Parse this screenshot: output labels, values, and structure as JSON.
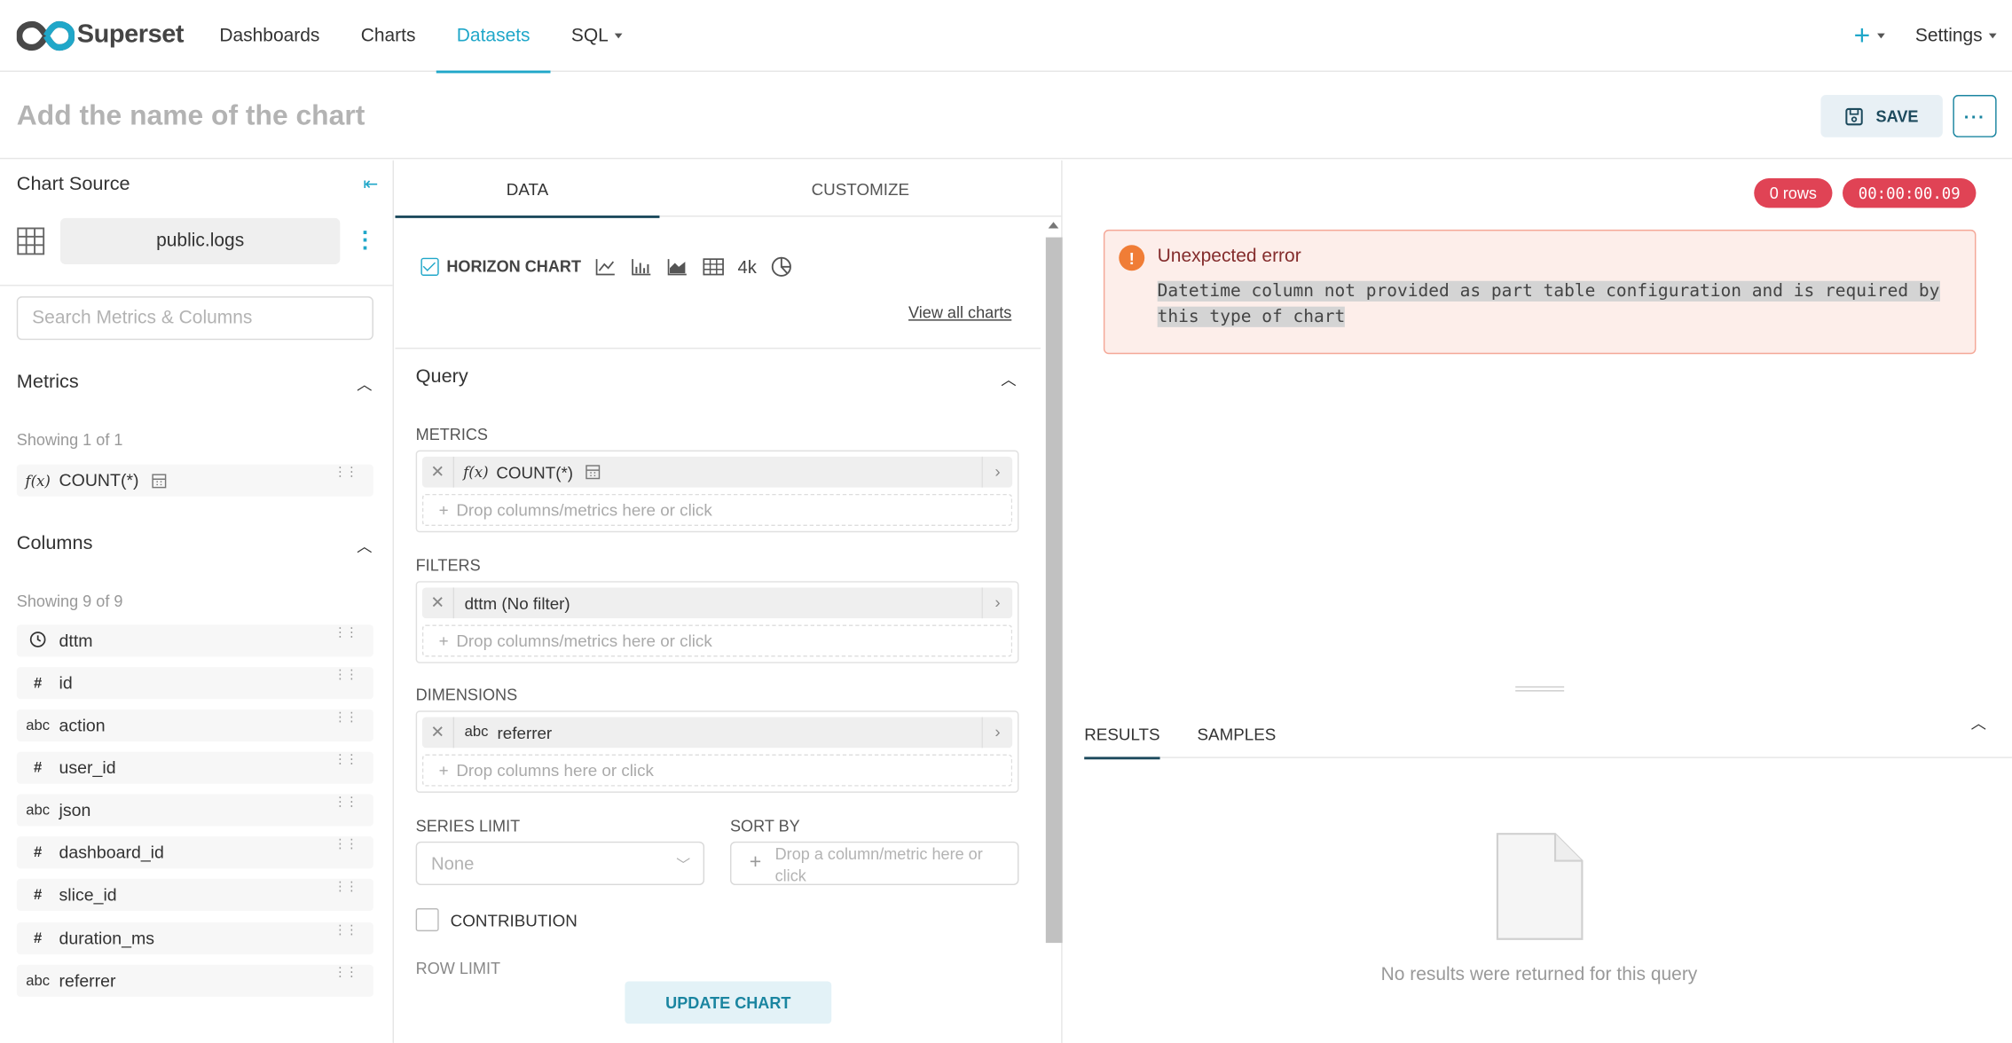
{
  "navbar": {
    "brand": "Superset",
    "menu": [
      "Dashboards",
      "Charts",
      "Datasets",
      "SQL"
    ],
    "active_menu": "Datasets",
    "settings": "Settings"
  },
  "header": {
    "title_placeholder": "Add the name of the chart",
    "save_label": "SAVE",
    "more_label": "···"
  },
  "left": {
    "title": "Chart Source",
    "dataset": "public.logs",
    "search_placeholder": "Search Metrics & Columns",
    "metrics_title": "Metrics",
    "metrics_showing": "Showing 1 of 1",
    "metrics": [
      {
        "type": "f(x)",
        "name": "COUNT(*)"
      }
    ],
    "columns_title": "Columns",
    "columns_showing": "Showing 9 of 9",
    "columns": [
      {
        "type": "clock",
        "name": "dttm"
      },
      {
        "type": "#",
        "name": "id"
      },
      {
        "type": "abc",
        "name": "action"
      },
      {
        "type": "#",
        "name": "user_id"
      },
      {
        "type": "abc",
        "name": "json"
      },
      {
        "type": "#",
        "name": "dashboard_id"
      },
      {
        "type": "#",
        "name": "slice_id"
      },
      {
        "type": "#",
        "name": "duration_ms"
      },
      {
        "type": "abc",
        "name": "referrer"
      }
    ]
  },
  "middle": {
    "tabs": [
      "DATA",
      "CUSTOMIZE"
    ],
    "viz_type": "HORIZON CHART",
    "viz_4k": "4k",
    "view_all": "View all charts",
    "query_title": "Query",
    "metrics_label": "METRICS",
    "metric_pill": "COUNT(*)",
    "metric_pill_prefix": "f(x)",
    "drop_metrics": "Drop columns/metrics here or click",
    "filters_label": "FILTERS",
    "filter_pill": "dttm (No filter)",
    "drop_filters": "Drop columns/metrics here or click",
    "dimensions_label": "DIMENSIONS",
    "dimension_pill_prefix": "abc",
    "dimension_pill": "referrer",
    "drop_dimensions": "Drop columns here or click",
    "series_limit_label": "SERIES LIMIT",
    "series_limit_value": "None",
    "sort_by_label": "SORT BY",
    "sort_by_placeholder": "Drop a column/metric here or click",
    "contribution_label": "CONTRIBUTION",
    "row_limit_label": "ROW LIMIT",
    "update_label": "UPDATE CHART"
  },
  "right": {
    "rows_badge": "0 rows",
    "time_badge": "00:00:00.09",
    "error_title": "Unexpected error",
    "error_message": "Datetime column not provided as part table configuration and is required by this type of chart",
    "tabs": [
      "RESULTS",
      "SAMPLES"
    ],
    "empty_text": "No results were returned for this query"
  },
  "colors": {
    "accent": "#20a7c9",
    "primary_dark": "#1d4a5d",
    "error_badge": "#e04355"
  }
}
